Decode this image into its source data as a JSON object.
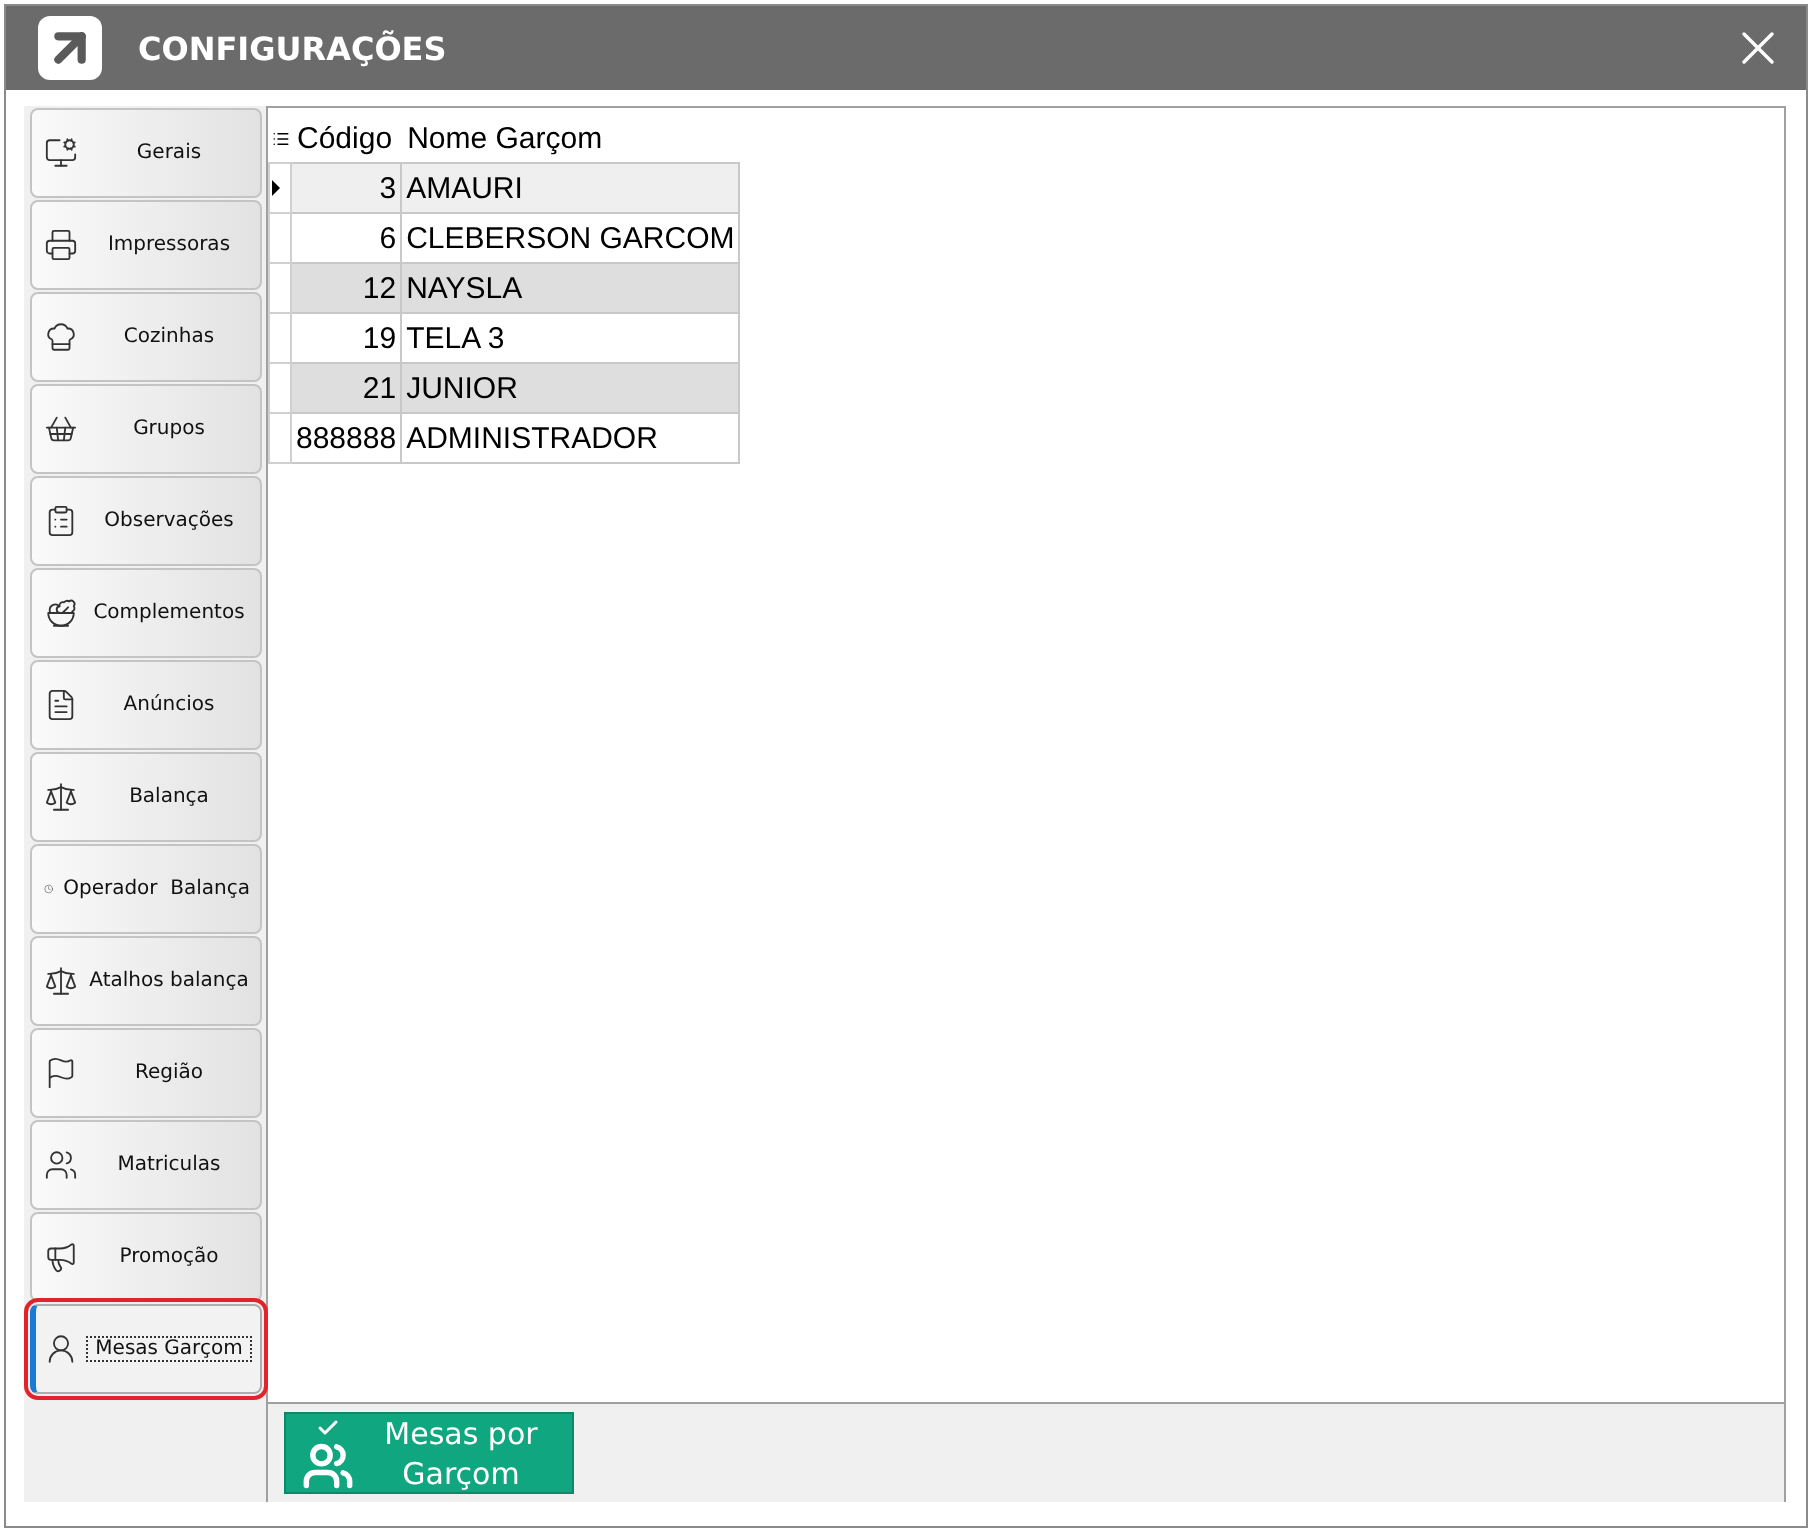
{
  "window": {
    "title": "CONFIGURAÇÕES"
  },
  "sidebar": {
    "items": [
      {
        "label": "Gerais",
        "selected": false
      },
      {
        "label": "Impressoras",
        "selected": false
      },
      {
        "label": "Cozinhas",
        "selected": false
      },
      {
        "label": "Grupos",
        "selected": false
      },
      {
        "label": "Observações",
        "selected": false
      },
      {
        "label": "Complementos",
        "selected": false
      },
      {
        "label": "Anúncios",
        "selected": false
      },
      {
        "label": "Balança",
        "selected": false
      },
      {
        "label": "Operador  Balança",
        "selected": false
      },
      {
        "label": "Atalhos balança",
        "selected": false
      },
      {
        "label": "Região",
        "selected": false
      },
      {
        "label": "Matriculas",
        "selected": false
      },
      {
        "label": "Promoção",
        "selected": false
      },
      {
        "label": "Mesas Garçom",
        "selected": true
      }
    ]
  },
  "table": {
    "columns": [
      "Código",
      "Nome Garçom"
    ],
    "rows": [
      {
        "cells": [
          "3",
          "AMAURI"
        ],
        "current": true
      },
      {
        "cells": [
          "6",
          "CLEBERSON GARCOM"
        ],
        "current": false
      },
      {
        "cells": [
          "12",
          "NAYSLA"
        ],
        "current": false
      },
      {
        "cells": [
          "19",
          "TELA 3"
        ],
        "current": false
      },
      {
        "cells": [
          "21",
          "JUNIOR"
        ],
        "current": false
      },
      {
        "cells": [
          "888888",
          "ADMINISTRADOR"
        ],
        "current": false
      }
    ]
  },
  "action_button": {
    "label": "Mesas por Garçom"
  }
}
